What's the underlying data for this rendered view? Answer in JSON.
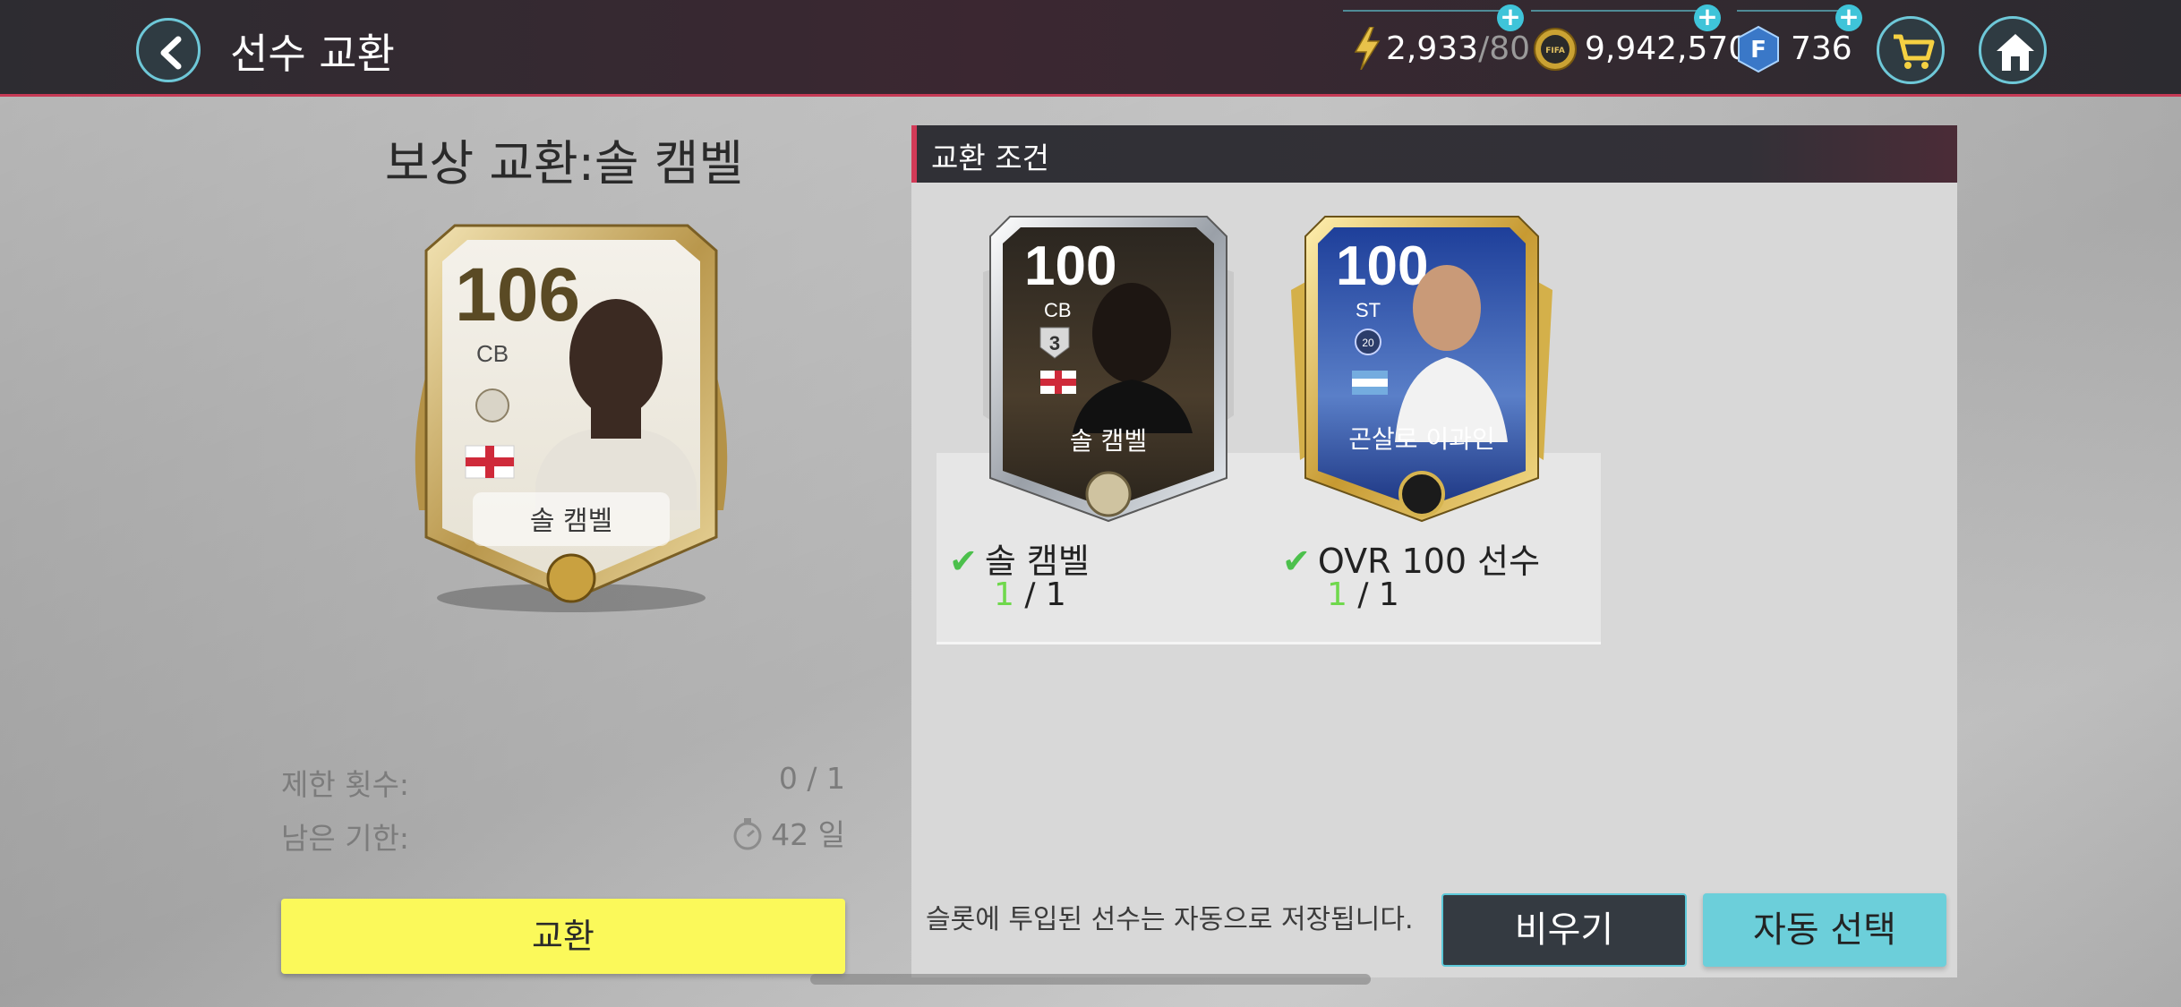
{
  "header": {
    "title": "선수 교환",
    "stamina": {
      "current": "2,933",
      "max": "/80"
    },
    "coins": "9,942,570",
    "fifa_points": "736",
    "icons": {
      "back": "chevron-left-icon",
      "stamina": "lightning-bolt-icon",
      "coin": "fifa-coin-icon",
      "points": "fifa-points-icon",
      "cart": "shopping-cart-icon",
      "home": "home-icon",
      "plus": "plus-icon"
    }
  },
  "reward": {
    "title": "보상 교환:솔 캠벨",
    "card": {
      "ovr": "106",
      "position": "CB",
      "name": "솔 캠벨"
    },
    "limit_label": "제한 횟수:",
    "limit_value": "0 / 1",
    "deadline_label": "남은 기한:",
    "deadline_value": "42 일",
    "exchange_button": "교환"
  },
  "conditions": {
    "title": "교환 조건",
    "slots": [
      {
        "card": {
          "ovr": "100",
          "position": "CB",
          "badge": "3",
          "name": "솔 캠벨"
        },
        "requirement": "솔 캠벨",
        "count_have": "1",
        "count_need": " / 1"
      },
      {
        "card": {
          "ovr": "100",
          "position": "ST",
          "badge": "20",
          "name": "곤살로 이과인"
        },
        "requirement": "OVR 100 선수",
        "count_have": "1",
        "count_need": " / 1"
      }
    ],
    "note": "슬롯에 투입된 선수는 자동으로 저장됩니다.",
    "clear_button": "비우기",
    "auto_select_button": "자동 선택"
  },
  "colors": {
    "accent_red": "#c63a55",
    "accent_cyan": "#6ec8d8",
    "exchange_yellow": "#fbf95a",
    "check_green": "#4cc04c"
  }
}
